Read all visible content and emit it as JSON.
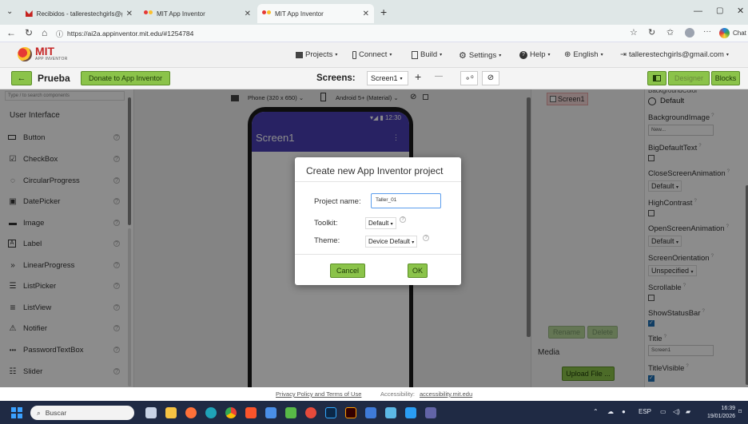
{
  "browser": {
    "tabs": [
      {
        "title": "Recibidos - tallerestechgirls@gmai"
      },
      {
        "title": "MIT App Inventor"
      },
      {
        "title": "MIT App Inventor"
      }
    ],
    "url": "https://ai2a.appinventor.mit.edu/#1254784",
    "chat_label": "Chat"
  },
  "app": {
    "logo_title": "MIT",
    "logo_sub": "APP INVENTOR",
    "menus": [
      "Projects",
      "Connect",
      "Build",
      "Settings",
      "Help",
      "English"
    ],
    "user": "tallerestechgirls@gmail.com"
  },
  "toolbar": {
    "project_name": "Prueba",
    "donate_label": "Donate to App Inventor",
    "screens_label": "Screens:",
    "screen_select": "Screen1",
    "add": "+",
    "remove": "—",
    "designer_label": "Designer",
    "blocks_label": "Blocks"
  },
  "palette": {
    "search_placeholder": "Type / to search components",
    "section": "User Interface",
    "items": [
      {
        "label": "Button",
        "icon": "button-icon"
      },
      {
        "label": "CheckBox",
        "icon": "checkbox-icon"
      },
      {
        "label": "CircularProgress",
        "icon": "circular-progress-icon"
      },
      {
        "label": "DatePicker",
        "icon": "calendar-icon"
      },
      {
        "label": "Image",
        "icon": "image-icon"
      },
      {
        "label": "Label",
        "icon": "label-icon"
      },
      {
        "label": "LinearProgress",
        "icon": "linear-progress-icon"
      },
      {
        "label": "ListPicker",
        "icon": "list-picker-icon"
      },
      {
        "label": "ListView",
        "icon": "list-view-icon"
      },
      {
        "label": "Notifier",
        "icon": "notifier-icon"
      },
      {
        "label": "PasswordTextBox",
        "icon": "password-icon"
      },
      {
        "label": "Slider",
        "icon": "slider-icon"
      }
    ],
    "help": "?"
  },
  "viewer": {
    "device": "Phone (320 x 650)",
    "theme": "Android 5+ (Material)",
    "time": "12:30",
    "screen_title": "Screen1"
  },
  "components": {
    "screen1": "Screen1",
    "rename": "Rename",
    "delete": "Delete",
    "media_label": "Media",
    "upload": "Upload File ..."
  },
  "properties": {
    "bg_color_label": "BackgroundColor",
    "bg_color_value": "Default",
    "bg_image_label": "BackgroundImage",
    "bg_image_value": "New...",
    "big_default_text": "BigDefaultText",
    "close_anim_label": "CloseScreenAnimation",
    "close_anim_value": "Default",
    "high_contrast": "HighContrast",
    "open_anim_label": "OpenScreenAnimation",
    "open_anim_value": "Default",
    "orientation_label": "ScreenOrientation",
    "orientation_value": "Unspecified",
    "scrollable": "Scrollable",
    "status_bar": "ShowStatusBar",
    "title_label": "Title",
    "title_value": "Screen1",
    "title_visible": "TitleVisible"
  },
  "dialog": {
    "title": "Create new App Inventor project",
    "name_label": "Project name:",
    "name_value": "Taller_01",
    "toolkit_label": "Toolkit:",
    "toolkit_value": "Default",
    "theme_label": "Theme:",
    "theme_value": "Device Default",
    "cancel": "Cancel",
    "ok": "OK"
  },
  "footer": {
    "privacy": "Privacy Policy and Terms of Use",
    "accessibility_prefix": "Accessibility:",
    "accessibility_link": "accessibility.mit.edu"
  },
  "taskbar": {
    "search": "Buscar",
    "lang": "ESP",
    "time": "16:39",
    "date": "19/01/2026"
  },
  "colors": {
    "accent_green": "#8bc34a",
    "app_purple": "#4a3fb5",
    "link_blue": "#1e6fb5"
  }
}
